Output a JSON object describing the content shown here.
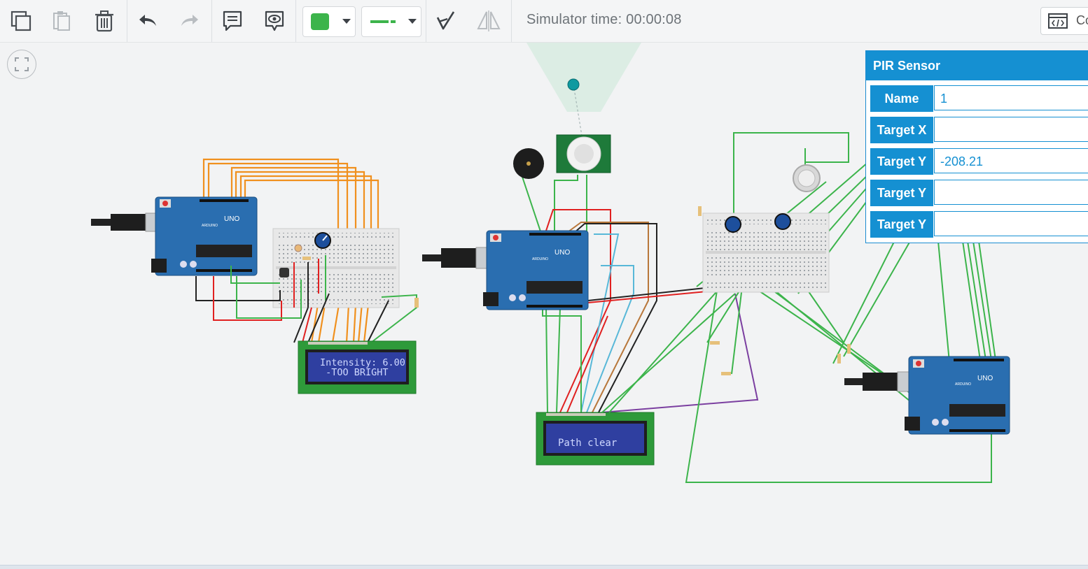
{
  "toolbar": {
    "icons": [
      "copy-icon",
      "paste-icon",
      "delete-icon",
      "undo-icon",
      "redo-icon",
      "notes-icon",
      "view-icon",
      "color-swatch",
      "wire-style",
      "annotate-icon",
      "flip-icon"
    ],
    "wire_color": "#3cb44b",
    "simulator_time_label": "Simulator time: 00:00:08",
    "code_button_label": "Co"
  },
  "lcd_left": {
    "line1": "Intensity: 6.00",
    "line2": " -TOO BRIGHT"
  },
  "lcd_center": {
    "line1": "Path clear",
    "line2": ""
  },
  "board_labels": {
    "uno": "UNO",
    "arduino": "ARDUINO"
  },
  "inspector": {
    "title": "PIR Sensor",
    "fields": [
      {
        "label": "Name",
        "value": "1"
      },
      {
        "label": "Target X",
        "value": ""
      },
      {
        "label": "Target Y",
        "value": "-208.21"
      },
      {
        "label": "Target Y",
        "value": ""
      },
      {
        "label": "Target Y",
        "value": ""
      }
    ]
  },
  "colors": {
    "accent": "#1590d2",
    "board": "#2a6eb0",
    "wire_orange": "#f0901e",
    "wire_green": "#3cb44b",
    "wire_red": "#e02020",
    "lcd_screen": "#2f3fa0"
  }
}
